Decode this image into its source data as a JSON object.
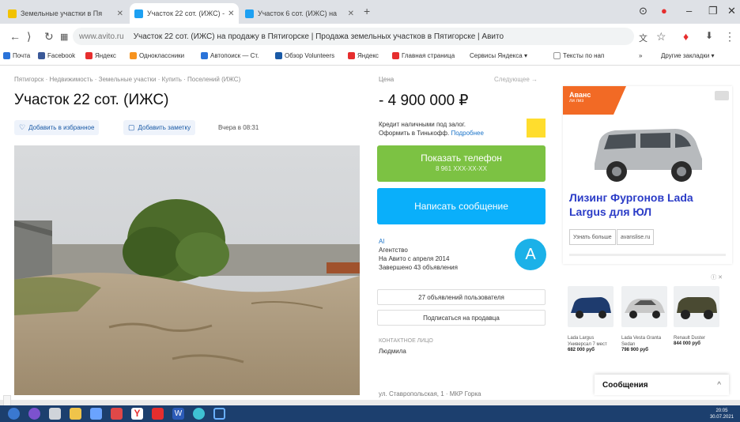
{
  "browser": {
    "tabs": [
      {
        "title": "Земельные участки в Пя",
        "color": "#f2c200",
        "active": false
      },
      {
        "title": "Участок 22 сот. (ИЖС) -",
        "color": "#1da0f2",
        "active": true
      },
      {
        "title": "Участок 6 сот. (ИЖС) на",
        "color": "#1da0f2",
        "active": false
      }
    ],
    "new_tab": "+",
    "address": {
      "domain": "www.avito.ru",
      "page_title": "Участок 22 сот. (ИЖС) на продажу в Пятигорске | Продажа земельных участков в Пятигорске | Авито"
    },
    "bookmarks": [
      {
        "label": "Почта",
        "color": "#2a73d9"
      },
      {
        "label": "Facebook",
        "color": "#3b5998"
      },
      {
        "label": "Яндекс",
        "color": "#e62e2e"
      },
      {
        "label": "Одноклассники",
        "color": "#f7931e"
      },
      {
        "label": "Автопоиск — Ст.",
        "color": "#2a73d9"
      },
      {
        "label": "Обзор Volunteers",
        "color": "#1a5aa6"
      },
      {
        "label": "Яндекс",
        "color": "#e62e2e"
      },
      {
        "label": "Главная страница",
        "color": "#e62e2e"
      },
      {
        "label": "Сервисы Яндекса ▾",
        "color": "#999999"
      },
      {
        "label": "Тексты по нап",
        "color": "#999999"
      },
      {
        "label": "»",
        "color": "#ffffff"
      },
      {
        "label": "Другие закладки ▾",
        "color": "#999999"
      }
    ]
  },
  "listing": {
    "breadcrumb": "Пятигорск · Недвижимость · Земельные участки · Купить · Поселений (ИЖС)",
    "title": "Участок 22 сот. (ИЖС)",
    "add_favorite": "Добавить в избранное",
    "add_note": "Добавить заметку",
    "posted": "Вчера в 08:31"
  },
  "sidebar": {
    "price_label": "Цена",
    "subscribe": "Следующее →",
    "price": "- 4 900 000 ₽",
    "credit_line1": "Кредит наличными под залог.",
    "credit_line2": "Оформить в Тинькофф.",
    "credit_link": "Подробнее",
    "phone_button": "Показать телефон",
    "phone_masked": "8 961 XXX-XX-XX",
    "message_button": "Написать сообщение",
    "seller_name": "Al",
    "seller_type": "Агентство",
    "seller_since": "На Авито с апреля 2014",
    "seller_done": "Завершено 43 объявления",
    "avatar_letter": "A",
    "user_ads_button": "27 объявлений пользователя",
    "subscribe_button": "Подписаться на продавца",
    "contact_label": "КОНТАКТНОЕ ЛИЦО",
    "contact_name": "Людмила",
    "address": "ул. Ставропольская, 1 · МКР Горка"
  },
  "ads": {
    "ad1_flag": "Аванс",
    "ad1_flag_sub": "ли лиз",
    "ad1_headline": "Лизинг Фургонов Lada Largus для ЮЛ",
    "ad1_btn1": "Узнать больше",
    "ad1_btn2": "avanslise.ru",
    "ad2_label": "Ⓘ ✕",
    "cars": [
      {
        "title": "Lada Largus Универсал 7 мест",
        "price": "682 000 руб",
        "color": "#1e3b6e"
      },
      {
        "title": "Lada Vesta Granta Sedan",
        "price": "798 900 руб",
        "color": "#c8c8c8"
      },
      {
        "title": "Renault Duster",
        "price": "844 000 руб",
        "color": "#4a4a32"
      }
    ]
  },
  "messages": {
    "label": "Сообщения",
    "chevron": "^"
  },
  "taskbar": {
    "time": "20:05",
    "date": "30.07.2021"
  }
}
